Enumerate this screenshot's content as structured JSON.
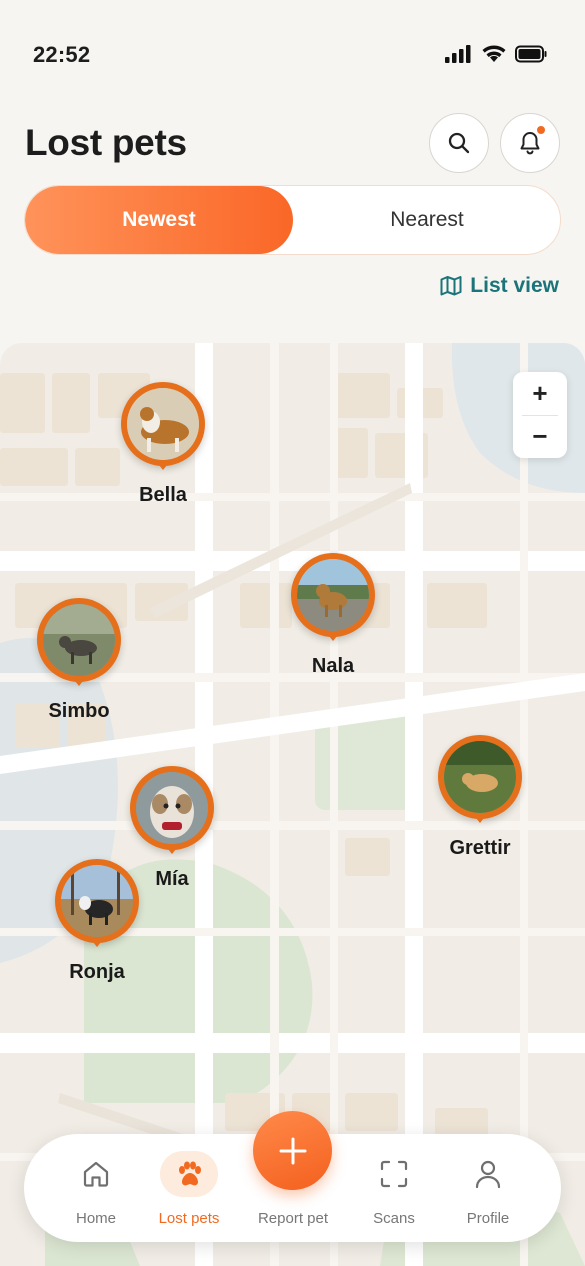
{
  "status_bar": {
    "time": "22:52"
  },
  "header": {
    "title": "Lost pets"
  },
  "segment": {
    "active_label": "Newest",
    "inactive_label": "Nearest"
  },
  "list_view": {
    "label": "List view"
  },
  "map": {
    "zoom_in": "+",
    "zoom_out": "−",
    "pets": [
      {
        "name": "Bella"
      },
      {
        "name": "Nala"
      },
      {
        "name": "Simbo"
      },
      {
        "name": "Grettir"
      },
      {
        "name": "Mía"
      },
      {
        "name": "Ronja"
      }
    ]
  },
  "nav": {
    "items": [
      {
        "label": "Home",
        "icon": "home-icon"
      },
      {
        "label": "Lost pets",
        "icon": "paw-icon"
      },
      {
        "label": "Report pet",
        "icon": "plus-icon"
      },
      {
        "label": "Scans",
        "icon": "scan-icon"
      },
      {
        "label": "Profile",
        "icon": "person-icon"
      }
    ]
  },
  "colors": {
    "accent": "#f26a21",
    "teal": "#1b7479",
    "map_bg": "#f1ede6"
  }
}
